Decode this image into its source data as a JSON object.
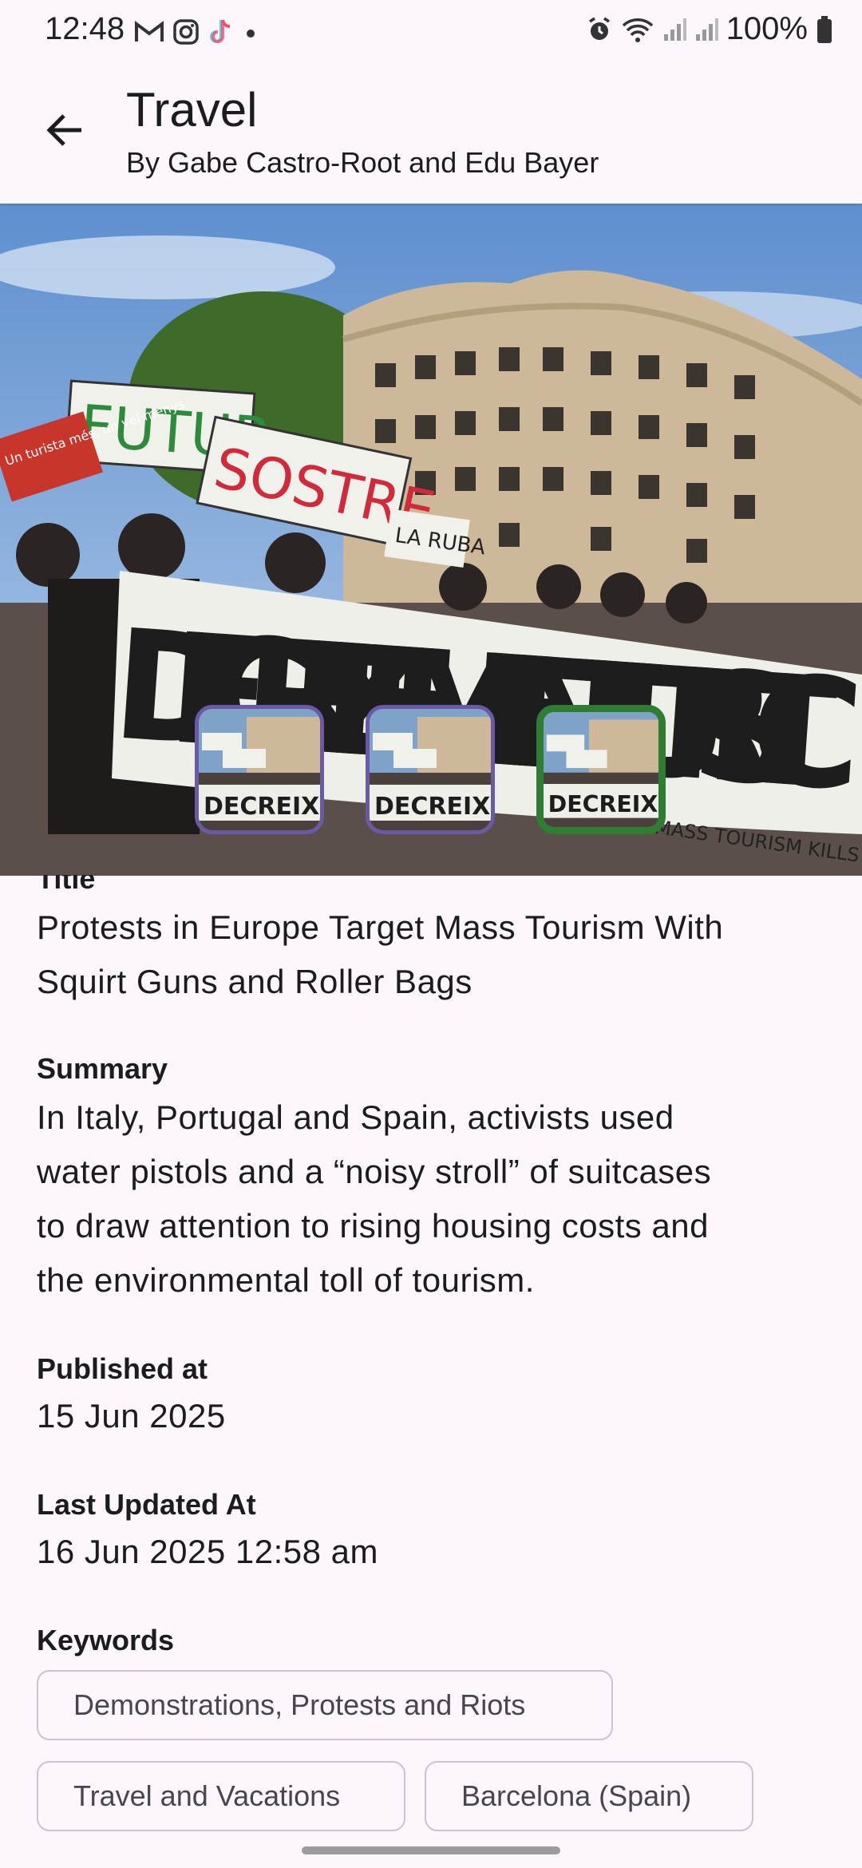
{
  "status_bar": {
    "time": "12:48",
    "battery": "100%",
    "left_icons": [
      "gmail-icon",
      "instagram-icon",
      "tiktok-icon",
      "dot-icon"
    ],
    "right_icons": [
      "alarm-icon",
      "wifi-icon",
      "signal-icon",
      "signal-icon",
      "battery-icon"
    ]
  },
  "app_bar": {
    "title": "Travel",
    "subtitle": "By Gabe Castro-Root and Edu Bayer"
  },
  "hero": {
    "banner_text": "DECREIXEMENT TURISTIC",
    "sign_texts": [
      "FUTUR",
      "SOSTRE",
      "Un turista més, un veí menys",
      "LA RUBA",
      "MASS TOURISM KILLS THE"
    ],
    "thumbnail_count": 3,
    "selected_thumbnail": 3
  },
  "article": {
    "title_label": "Title",
    "title_line1": "Protests in Europe Target Mass Tourism With",
    "title_line2": "Squirt Guns and Roller Bags",
    "summary_label": "Summary",
    "summary_line1": "In Italy, Portugal and Spain, activists used",
    "summary_line2": "water pistols and a “noisy stroll” of suitcases",
    "summary_line3": "to draw attention to rising housing costs and",
    "summary_line4": "the environmental toll of tourism.",
    "published_label": "Published at",
    "published_value": "15 Jun 2025",
    "updated_label": "Last Updated At",
    "updated_value": "16 Jun 2025 12:58 am",
    "keywords_label": "Keywords",
    "keywords": [
      "Demonstrations, Protests and Riots",
      "Travel and Vacations",
      "Barcelona (Spain)"
    ]
  },
  "colors": {
    "background": "#fdf7fd",
    "thumb_border": "#6a5aa6",
    "thumb_selected_border": "#2e7d32",
    "chip_border": "#cac4d0"
  }
}
